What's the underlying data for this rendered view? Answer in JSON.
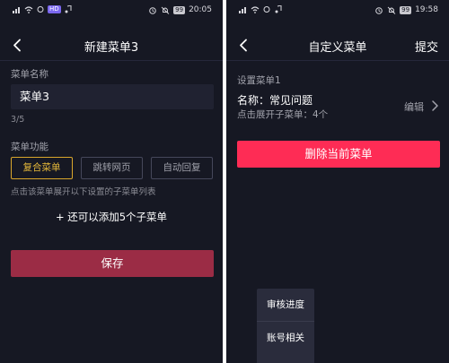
{
  "left": {
    "status": {
      "battery": "99",
      "time": "20:05",
      "hd_badge": "HD"
    },
    "nav": {
      "title": "新建菜单3"
    },
    "name_label": "菜单名称",
    "name_value": "菜单3",
    "name_counter": "3/5",
    "function_label": "菜单功能",
    "function_options": [
      "复合菜单",
      "跳转网页",
      "自动回复"
    ],
    "selected_function": "复合菜单",
    "hint": "点击该菜单展开以下设置的子菜单列表",
    "add_submenu": "+ 还可以添加5个子菜单",
    "save_label": "保存"
  },
  "right": {
    "status": {
      "battery": "99",
      "time": "19:58"
    },
    "nav": {
      "title": "自定义菜单",
      "action": "提交"
    },
    "section_label": "设置菜单1",
    "menu_name": "名称：常见问题",
    "menu_sub": "点击展开子菜单：4个",
    "edit_label": "编辑",
    "delete_label": "删除当前菜单",
    "popup_items": [
      "审核进度",
      "账号相关"
    ]
  },
  "colors": {
    "background": "#161823",
    "accent_gold": "#d9a62c",
    "save_button": "#9b2c45",
    "delete_button": "#fe2c55"
  }
}
